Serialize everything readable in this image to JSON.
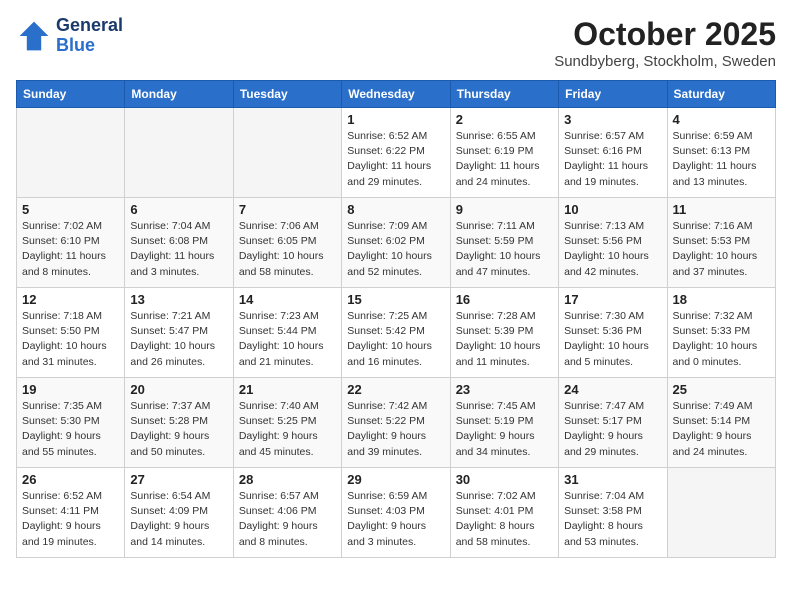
{
  "header": {
    "logo_line1": "General",
    "logo_line2": "Blue",
    "month": "October 2025",
    "location": "Sundbyberg, Stockholm, Sweden"
  },
  "weekdays": [
    "Sunday",
    "Monday",
    "Tuesday",
    "Wednesday",
    "Thursday",
    "Friday",
    "Saturday"
  ],
  "weeks": [
    [
      {
        "day": "",
        "info": ""
      },
      {
        "day": "",
        "info": ""
      },
      {
        "day": "",
        "info": ""
      },
      {
        "day": "1",
        "info": "Sunrise: 6:52 AM\nSunset: 6:22 PM\nDaylight: 11 hours\nand 29 minutes."
      },
      {
        "day": "2",
        "info": "Sunrise: 6:55 AM\nSunset: 6:19 PM\nDaylight: 11 hours\nand 24 minutes."
      },
      {
        "day": "3",
        "info": "Sunrise: 6:57 AM\nSunset: 6:16 PM\nDaylight: 11 hours\nand 19 minutes."
      },
      {
        "day": "4",
        "info": "Sunrise: 6:59 AM\nSunset: 6:13 PM\nDaylight: 11 hours\nand 13 minutes."
      }
    ],
    [
      {
        "day": "5",
        "info": "Sunrise: 7:02 AM\nSunset: 6:10 PM\nDaylight: 11 hours\nand 8 minutes."
      },
      {
        "day": "6",
        "info": "Sunrise: 7:04 AM\nSunset: 6:08 PM\nDaylight: 11 hours\nand 3 minutes."
      },
      {
        "day": "7",
        "info": "Sunrise: 7:06 AM\nSunset: 6:05 PM\nDaylight: 10 hours\nand 58 minutes."
      },
      {
        "day": "8",
        "info": "Sunrise: 7:09 AM\nSunset: 6:02 PM\nDaylight: 10 hours\nand 52 minutes."
      },
      {
        "day": "9",
        "info": "Sunrise: 7:11 AM\nSunset: 5:59 PM\nDaylight: 10 hours\nand 47 minutes."
      },
      {
        "day": "10",
        "info": "Sunrise: 7:13 AM\nSunset: 5:56 PM\nDaylight: 10 hours\nand 42 minutes."
      },
      {
        "day": "11",
        "info": "Sunrise: 7:16 AM\nSunset: 5:53 PM\nDaylight: 10 hours\nand 37 minutes."
      }
    ],
    [
      {
        "day": "12",
        "info": "Sunrise: 7:18 AM\nSunset: 5:50 PM\nDaylight: 10 hours\nand 31 minutes."
      },
      {
        "day": "13",
        "info": "Sunrise: 7:21 AM\nSunset: 5:47 PM\nDaylight: 10 hours\nand 26 minutes."
      },
      {
        "day": "14",
        "info": "Sunrise: 7:23 AM\nSunset: 5:44 PM\nDaylight: 10 hours\nand 21 minutes."
      },
      {
        "day": "15",
        "info": "Sunrise: 7:25 AM\nSunset: 5:42 PM\nDaylight: 10 hours\nand 16 minutes."
      },
      {
        "day": "16",
        "info": "Sunrise: 7:28 AM\nSunset: 5:39 PM\nDaylight: 10 hours\nand 11 minutes."
      },
      {
        "day": "17",
        "info": "Sunrise: 7:30 AM\nSunset: 5:36 PM\nDaylight: 10 hours\nand 5 minutes."
      },
      {
        "day": "18",
        "info": "Sunrise: 7:32 AM\nSunset: 5:33 PM\nDaylight: 10 hours\nand 0 minutes."
      }
    ],
    [
      {
        "day": "19",
        "info": "Sunrise: 7:35 AM\nSunset: 5:30 PM\nDaylight: 9 hours\nand 55 minutes."
      },
      {
        "day": "20",
        "info": "Sunrise: 7:37 AM\nSunset: 5:28 PM\nDaylight: 9 hours\nand 50 minutes."
      },
      {
        "day": "21",
        "info": "Sunrise: 7:40 AM\nSunset: 5:25 PM\nDaylight: 9 hours\nand 45 minutes."
      },
      {
        "day": "22",
        "info": "Sunrise: 7:42 AM\nSunset: 5:22 PM\nDaylight: 9 hours\nand 39 minutes."
      },
      {
        "day": "23",
        "info": "Sunrise: 7:45 AM\nSunset: 5:19 PM\nDaylight: 9 hours\nand 34 minutes."
      },
      {
        "day": "24",
        "info": "Sunrise: 7:47 AM\nSunset: 5:17 PM\nDaylight: 9 hours\nand 29 minutes."
      },
      {
        "day": "25",
        "info": "Sunrise: 7:49 AM\nSunset: 5:14 PM\nDaylight: 9 hours\nand 24 minutes."
      }
    ],
    [
      {
        "day": "26",
        "info": "Sunrise: 6:52 AM\nSunset: 4:11 PM\nDaylight: 9 hours\nand 19 minutes."
      },
      {
        "day": "27",
        "info": "Sunrise: 6:54 AM\nSunset: 4:09 PM\nDaylight: 9 hours\nand 14 minutes."
      },
      {
        "day": "28",
        "info": "Sunrise: 6:57 AM\nSunset: 4:06 PM\nDaylight: 9 hours\nand 8 minutes."
      },
      {
        "day": "29",
        "info": "Sunrise: 6:59 AM\nSunset: 4:03 PM\nDaylight: 9 hours\nand 3 minutes."
      },
      {
        "day": "30",
        "info": "Sunrise: 7:02 AM\nSunset: 4:01 PM\nDaylight: 8 hours\nand 58 minutes."
      },
      {
        "day": "31",
        "info": "Sunrise: 7:04 AM\nSunset: 3:58 PM\nDaylight: 8 hours\nand 53 minutes."
      },
      {
        "day": "",
        "info": ""
      }
    ]
  ]
}
